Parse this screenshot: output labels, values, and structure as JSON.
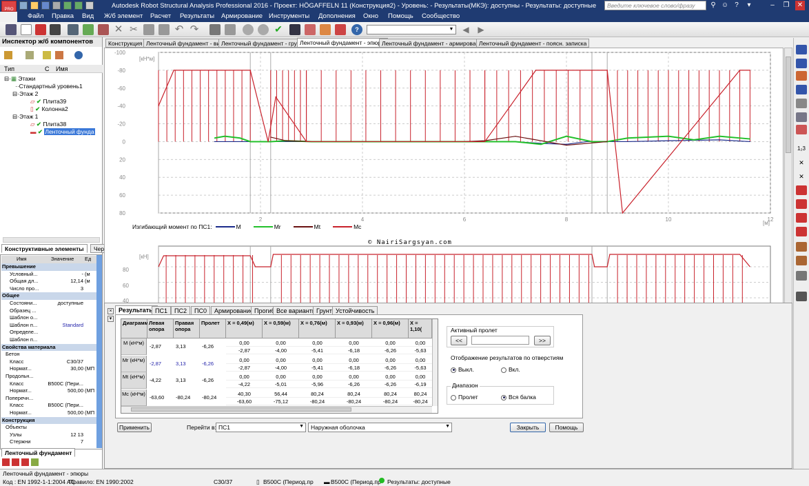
{
  "window": {
    "app_badge": "PRO",
    "title": "Autodesk Robot Structural Analysis Professional 2016 - Проект: HÖGAFFELN 11 (Конструкция2) - Уровень: - Результаты(МКЭ): доступны - Результаты: доступные",
    "search_placeholder": "Введите ключевое слово/фразу"
  },
  "menu": [
    "Файл",
    "Правка",
    "Вид",
    "Ж/б элемент",
    "Расчет",
    "Результаты",
    "Армирование",
    "Инструменты",
    "Дополнения",
    "Окно",
    "Помощь",
    "Сообщество"
  ],
  "inspector": {
    "title": "Инспектор ж/б компонентов",
    "col_type": "Тип",
    "col_c": "С",
    "col_name": "Имя",
    "tree": [
      {
        "label": "Этажи"
      },
      {
        "label": "Стандартный уровень1"
      },
      {
        "label": "Этаж 2"
      },
      {
        "label": "Плита39"
      },
      {
        "label": "Колонна2"
      },
      {
        "label": "Этаж 1"
      },
      {
        "label": "Плита38"
      },
      {
        "label": "Ленточный фунда"
      }
    ],
    "tab_elements": "Конструктивные элементы",
    "tab_drawings": "Черт",
    "bottom_tab": "Ленточный фундамент"
  },
  "props": {
    "headers": [
      "Имя",
      "Значение",
      "Ед"
    ],
    "rows": [
      {
        "kind": "group",
        "name": "Превышение"
      },
      {
        "name": "Условный...",
        "value": "-",
        "unit": "(м"
      },
      {
        "name": "Общая дл...",
        "value": "12,14",
        "unit": "(м"
      },
      {
        "name": "Число про...",
        "value": "3",
        "unit": ""
      },
      {
        "kind": "group",
        "name": "Общее"
      },
      {
        "name": "Состояни...",
        "value": "доступные",
        "unit": ""
      },
      {
        "name": "Образец ...",
        "value": "",
        "unit": ""
      },
      {
        "name": "Шаблон о...",
        "value": "",
        "unit": ""
      },
      {
        "name": "Шаблон п...",
        "value": "Standard",
        "unit": ""
      },
      {
        "name": "Определе...",
        "value": "",
        "unit": ""
      },
      {
        "name": "Шаблон п...",
        "value": "",
        "unit": ""
      },
      {
        "kind": "group",
        "name": "Свойства материала"
      },
      {
        "kind": "sub",
        "name": "Бетон"
      },
      {
        "name": "Класс",
        "value": "C30/37",
        "unit": ""
      },
      {
        "name": "Нормат...",
        "value": "30,00",
        "unit": "(МП"
      },
      {
        "kind": "sub",
        "name": "Продольн..."
      },
      {
        "name": "Класс",
        "value": "B500C (Пери...",
        "unit": ""
      },
      {
        "name": "Нормат...",
        "value": "500,00",
        "unit": "(МП"
      },
      {
        "kind": "sub",
        "name": "Поперечн..."
      },
      {
        "name": "Класс",
        "value": "B500C (Пери...",
        "unit": ""
      },
      {
        "name": "Нормат...",
        "value": "500,00",
        "unit": "(МП"
      },
      {
        "kind": "group",
        "name": "Конструкция"
      },
      {
        "kind": "sub",
        "name": "Объекты"
      },
      {
        "name": "Узлы",
        "value": "12 13",
        "unit": ""
      },
      {
        "name": "Стержни",
        "value": "7",
        "unit": ""
      }
    ]
  },
  "doc_tabs": [
    "Конструкция",
    "Ленточный фундамент - вид",
    "Ленточный фундамент - грунт",
    "Ленточный фундамент - эпюры",
    "Ленточный фундамент - армирование",
    "Ленточный фундамент - поясн. записка"
  ],
  "chart": {
    "unit_y": "[кН*м]",
    "unit_x": "[м]",
    "legend_title": "Изгибающий момент по ПС1:",
    "legend": [
      {
        "name": "M",
        "color": "#1a2a8a"
      },
      {
        "name": "Mr",
        "color": "#22c02a"
      },
      {
        "name": "Mt",
        "color": "#6a1010"
      },
      {
        "name": "Mc",
        "color": "#c8202a"
      }
    ],
    "watermark": "© NairiSargsyan.com",
    "unit_y2": "[кН]",
    "y2_ticks": [
      "80",
      "60",
      "40"
    ]
  },
  "chart_data": {
    "type": "line",
    "title": "",
    "xlabel": "[м]",
    "ylabel": "[кН*м]",
    "xlim": [
      0,
      12
    ],
    "ylim": [
      -100,
      80
    ],
    "x_ticks": [
      2,
      4,
      6,
      8,
      10,
      12
    ],
    "y_ticks": [
      -100,
      -80,
      -60,
      -40,
      -20,
      0,
      20,
      40,
      60,
      80
    ],
    "series": [
      {
        "name": "M",
        "x": [
          1.1,
          1.5,
          1.8,
          2.2,
          2.5,
          3.0,
          6.0,
          6.4,
          7.0,
          7.5,
          8.0,
          8.4,
          8.8,
          9.2,
          10.0,
          11.0,
          11.6
        ],
        "y": [
          0,
          0,
          0,
          0,
          0,
          0,
          0,
          0,
          0,
          2,
          3,
          0,
          0,
          0,
          -1,
          -2,
          0
        ]
      },
      {
        "name": "Mr",
        "x": [
          1.1,
          1.3,
          1.6,
          1.8,
          2.2,
          2.5,
          3.0,
          6.0,
          6.4,
          7.0,
          7.5,
          8.0,
          8.5,
          8.8,
          9.2,
          10.0,
          10.5,
          11.0,
          11.6
        ],
        "y": [
          -4,
          -6,
          -4,
          0,
          0,
          -1,
          0,
          0,
          0,
          0,
          3,
          -6,
          0,
          0,
          -4,
          -6,
          -2,
          -6,
          -3
        ]
      },
      {
        "name": "Mt",
        "x": [
          2.2,
          2.5,
          3.0,
          6.0,
          6.4,
          7.0,
          8.0,
          8.8
        ],
        "y": [
          -5,
          -1,
          0,
          0,
          -1,
          -6,
          4,
          0
        ]
      },
      {
        "name": "Mc",
        "x": [
          0.0,
          0.3,
          1.8,
          2.15,
          2.3,
          2.9,
          6.4,
          6.9,
          7.4,
          8.8,
          9.1,
          11.4,
          11.6
        ],
        "y": [
          -40,
          -80,
          -80,
          0,
          -50,
          0,
          0,
          -40,
          -80,
          -80,
          80,
          -80,
          -80
        ]
      }
    ]
  },
  "results": {
    "tabs": [
      "Результаты",
      "ПС1",
      "ПС2",
      "ПС0",
      "Армирование",
      "Прогиб",
      "Все варианты",
      "Грунт",
      "Устойчивость"
    ],
    "headers": [
      "Диаграмма",
      "Левая опора",
      "Правая опора",
      "Пролет",
      "X = 0,49(м)",
      "X = 0,59(м)",
      "X = 0,76(м)",
      "X = 0,93(м)",
      "X = 0,96(м)",
      "X = 1,10("
    ],
    "rows": [
      {
        "label": "M (кН*м)",
        "left": "-2,87",
        "right": "3,13",
        "span": "-6,26",
        "vals": [
          [
            "0,00",
            "0,00",
            "0,00",
            "0,00",
            "0,00",
            "0,00"
          ],
          [
            "-2,87",
            "-4,00",
            "-5,41",
            "-6,18",
            "-6,26",
            "-5,63"
          ]
        ]
      },
      {
        "label": "Mr (кН*м)",
        "left": "-2,87",
        "right": "3,13",
        "span": "-6,26",
        "blue": true,
        "vals": [
          [
            "0,00",
            "0,00",
            "0,00",
            "0,00",
            "0,00",
            "0,00"
          ],
          [
            "-2,87",
            "-4,00",
            "-5,41",
            "-6,18",
            "-6,26",
            "-5,63"
          ]
        ]
      },
      {
        "label": "Mt (кН*м)",
        "left": "-4,22",
        "right": "3,13",
        "span": "-6,26",
        "vals": [
          [
            "0,00",
            "0,00",
            "0,00",
            "0,00",
            "0,00",
            "0,00"
          ],
          [
            "-4,22",
            "-5,01",
            "-5,96",
            "-6,26",
            "-6,26",
            "-6,19"
          ]
        ]
      },
      {
        "label": "Mc (кН*м)",
        "left": "-63,60",
        "right": "-80,24",
        "span": "-80,24",
        "vals": [
          [
            "40,30",
            "56,44",
            "80,24",
            "80,24",
            "80,24",
            "80,24"
          ],
          [
            "-63,60",
            "-75,12",
            "-80,24",
            "-80,24",
            "-80,24",
            "-80,24"
          ]
        ]
      }
    ],
    "active_span_title": "Активный пролет",
    "prev": "<<",
    "next": ">>",
    "openings_title": "Отображение результатов по отверстиям",
    "opt_off": "Выкл.",
    "opt_on": "Вкл.",
    "range_title": "Диапазон",
    "range_span": "Пролет",
    "range_all": "Вся балка",
    "apply": "Применить",
    "goto_label": "Перейти в:",
    "goto_value": "ПС1",
    "shell_value": "Наружная оболочка",
    "close": "Закрыть",
    "help": "Помощь"
  },
  "status": {
    "view_name": "Ленточный фундамент - эпюры",
    "code": "Код : EN 1992-1-1:2004 AC",
    "rule": "Правило: EN 1990:2002",
    "concrete": "C30/37",
    "steel1": "B500C (Период.пр",
    "steel2": "B500C (Период.пр",
    "results": "Результаты: доступные"
  }
}
